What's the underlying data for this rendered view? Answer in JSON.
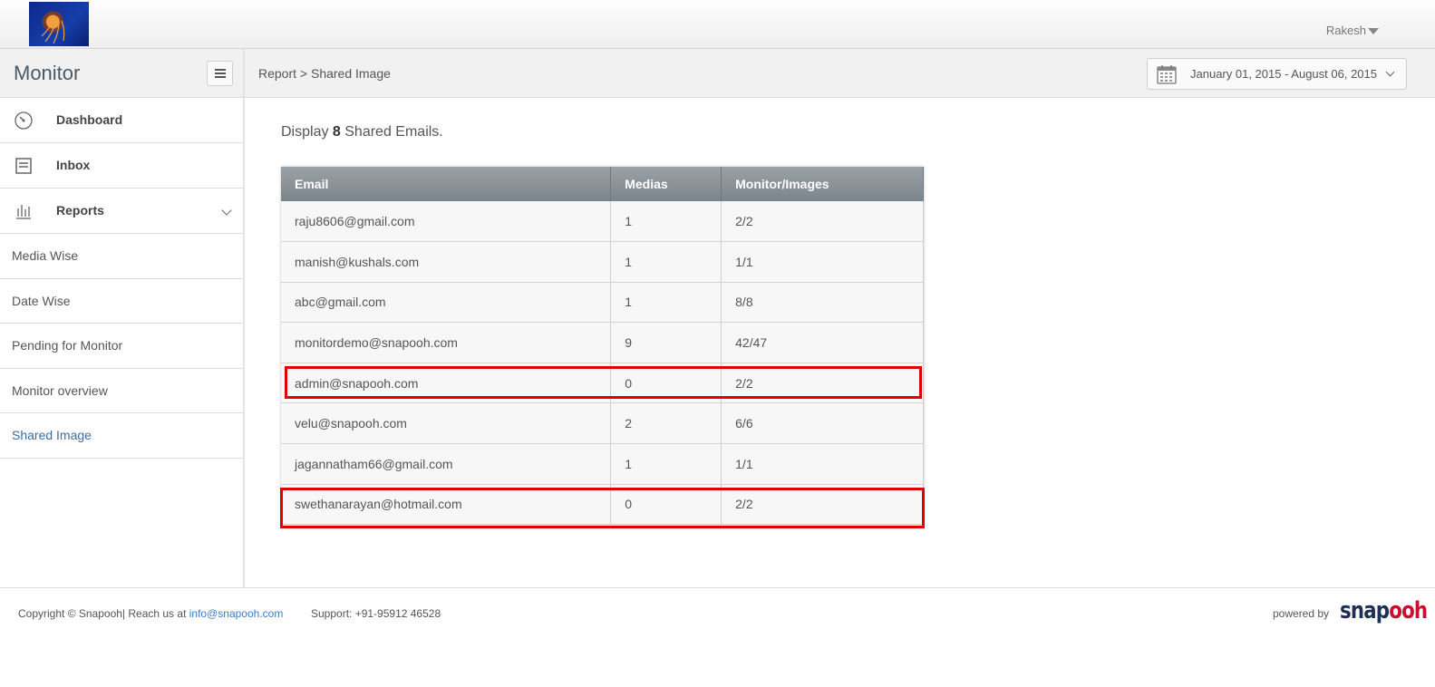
{
  "header": {
    "user_name": "Rakesh"
  },
  "sidebar": {
    "title": "Monitor",
    "nav": [
      {
        "label": "Dashboard",
        "icon": "speedometer-icon"
      },
      {
        "label": "Inbox",
        "icon": "inbox-icon"
      },
      {
        "label": "Reports",
        "icon": "bar-chart-icon",
        "expanded": true
      }
    ],
    "sub_items": [
      {
        "label": "Media Wise"
      },
      {
        "label": "Date Wise"
      },
      {
        "label": "Pending for Monitor"
      },
      {
        "label": "Monitor overview"
      },
      {
        "label": "Shared Image",
        "active": true
      }
    ]
  },
  "breadcrumb": "Report > Shared Image",
  "date_range": "January 01, 2015 - August 06, 2015",
  "summary": {
    "prefix": "Display ",
    "count": "8",
    "suffix": " Shared Emails."
  },
  "table": {
    "headers": [
      "Email",
      "Medias",
      "Monitor/Images"
    ],
    "rows": [
      [
        "raju8606@gmail.com",
        "1",
        "2/2"
      ],
      [
        "manish@kushals.com",
        "1",
        "1/1"
      ],
      [
        "abc@gmail.com",
        "1",
        "8/8"
      ],
      [
        "monitordemo@snapooh.com",
        "9",
        "42/47"
      ],
      [
        "admin@snapooh.com",
        "0",
        "2/2"
      ],
      [
        "velu@snapooh.com",
        "2",
        "6/6"
      ],
      [
        "jagannatham66@gmail.com",
        "1",
        "1/1"
      ],
      [
        "swethanarayan@hotmail.com",
        "0",
        "2/2"
      ]
    ],
    "highlighted_rows": [
      4,
      7
    ],
    "highlight_color": "#e00000"
  },
  "footer": {
    "copyright": "Copyright © Snapooh| Reach us at ",
    "email": "info@snapooh.com",
    "support": "Support: +91-95912 46528",
    "powered_by": "powered by",
    "brand_part1": "snap",
    "brand_part2": "ooh"
  },
  "colors": {
    "accent_link": "#3a6ea5",
    "table_header": "#8a9197",
    "brand_dark": "#1e2f55",
    "brand_red": "#c8102e"
  }
}
